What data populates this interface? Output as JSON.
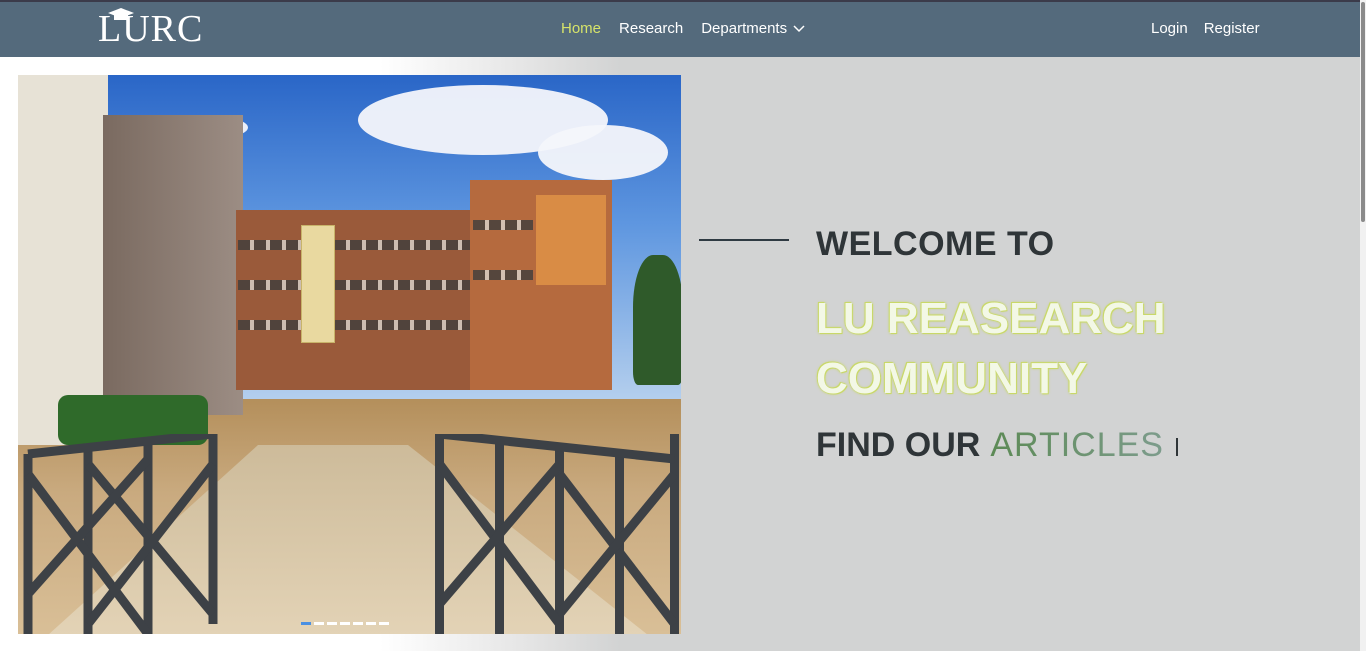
{
  "brand": {
    "logo_text": "LURC"
  },
  "nav": {
    "home": "Home",
    "research": "Research",
    "departments": "Departments",
    "login": "Login",
    "register": "Register",
    "active_color": "#d6e36a",
    "bar_color": "#546a7c"
  },
  "hero": {
    "welcome": "WELCOME TO",
    "title": "LU REASEARCH COMMUNITY",
    "find_prefix": "FIND OUR",
    "find_typed": "ARTICLES"
  },
  "carousel": {
    "slide_count": 7,
    "active_index": 0
  },
  "icons": [
    "graduation-cap-icon",
    "chevron-down-icon"
  ]
}
